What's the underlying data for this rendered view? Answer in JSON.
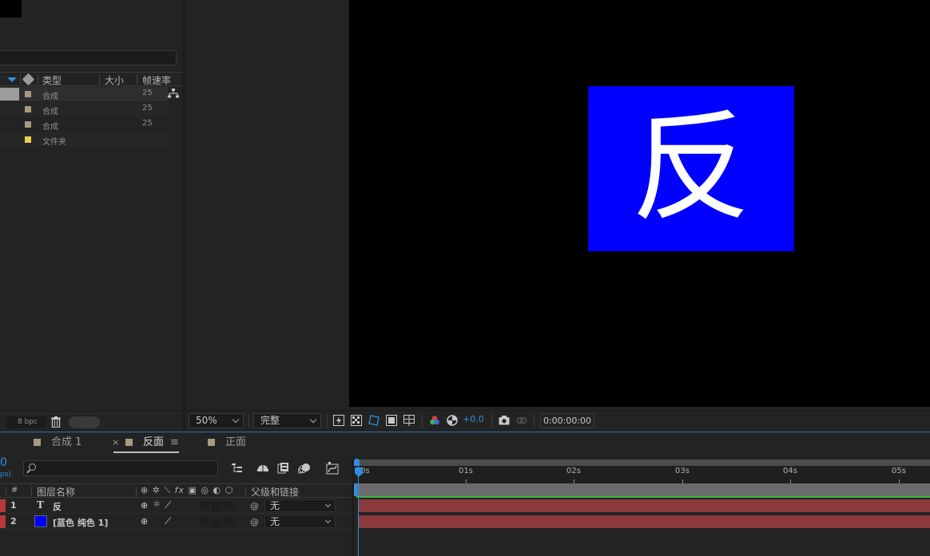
{
  "project": {
    "columns": {
      "type": "类型",
      "size": "大小",
      "fps": "帧速率"
    },
    "items": [
      {
        "type": "合成",
        "fps": "25",
        "color": "#a89a82"
      },
      {
        "type": "合成",
        "fps": "25",
        "color": "#a89a82"
      },
      {
        "type": "合成",
        "fps": "25",
        "color": "#a89a82"
      },
      {
        "type": "文件夹",
        "fps": "",
        "color": "#e8d44a"
      }
    ],
    "bpc": "8 bpc"
  },
  "viewer": {
    "solid_color": "#0000ff",
    "solid_text": "反",
    "zoom": "50%",
    "resolution": "完整",
    "exposure": "+0.0",
    "timecode": "0:00:00:00"
  },
  "timeline": {
    "tabs": [
      {
        "label": "合成 1"
      },
      {
        "label": "反面"
      },
      {
        "label": "正面"
      }
    ],
    "current_time": "0",
    "fps_fragment": "ps)",
    "headers": {
      "number": "#",
      "layer_name": "图层名称",
      "parent": "父级和链接"
    },
    "layers": [
      {
        "num": "1",
        "name": "反",
        "kind": "text",
        "parent": "无"
      },
      {
        "num": "2",
        "name": "[蓝色 纯色 1]",
        "kind": "solid",
        "parent": "无"
      }
    ],
    "ruler": [
      "0s",
      "01s",
      "02s",
      "03s",
      "04s",
      "05s"
    ]
  }
}
